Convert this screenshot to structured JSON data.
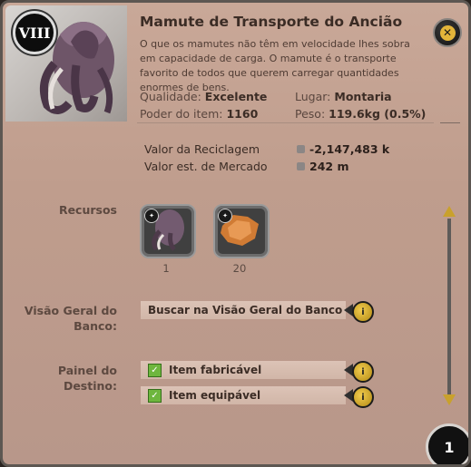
{
  "item": {
    "tier": "VIII",
    "title": "Mamute de Transporte do Ancião",
    "description": "O que os mamutes não têm em velocidade lhes sobra em capacidade de carga. O mamute é o transporte favorito de todos que querem carregar quantidades enormes de bens."
  },
  "stats": {
    "quality_label": "Qualidade:",
    "quality_value": "Excelente",
    "slot_label": "Lugar:",
    "slot_value": "Montaria",
    "power_label": "Poder do item:",
    "power_value": "1160",
    "weight_label": "Peso:",
    "weight_value": "119.6kg (0.5%)"
  },
  "values": {
    "recycle_label": "Valor da Reciclagem",
    "recycle_value": "-2,147,483 k",
    "market_label": "Valor est. de Mercado",
    "market_value": "242 m"
  },
  "resources": {
    "label": "Recursos",
    "items": [
      {
        "icon": "mammoth-icon",
        "count": "1"
      },
      {
        "icon": "hide-icon",
        "count": "20"
      }
    ]
  },
  "bank": {
    "label_line1": "Visão Geral do",
    "label_line2": "Banco:",
    "button": "Buscar na Visão Geral do Banco"
  },
  "destiny": {
    "label_line1": "Painel do",
    "label_line2": "Destino:",
    "items": [
      {
        "label": "Item fabricável",
        "checked": true
      },
      {
        "label": "Item equipável",
        "checked": true
      }
    ]
  },
  "page_number": "1",
  "colors": {
    "accent": "#e3b53a",
    "check": "#6eb63e",
    "panel": "#c3a191"
  }
}
